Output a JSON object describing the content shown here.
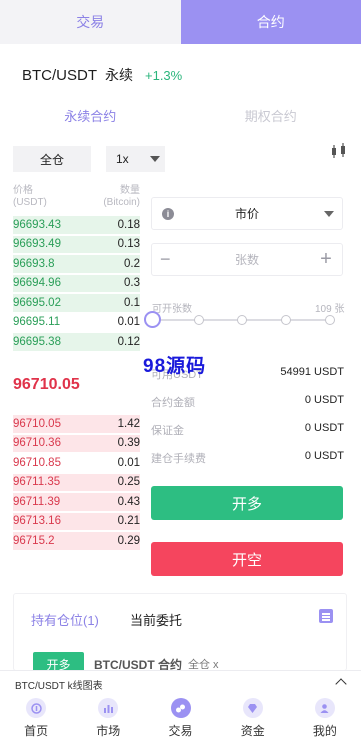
{
  "top_tabs": {
    "spot": "交易",
    "contract": "合约"
  },
  "pair": {
    "name": "BTC/USDT",
    "type": "永续",
    "change": "+1.3%"
  },
  "sub_tabs": {
    "perpetual": "永续合约",
    "futures": "期权合约"
  },
  "margin_mode": "全仓",
  "leverage": "1x",
  "order_book": {
    "price_header": "价格",
    "price_unit": "(USDT)",
    "qty_header": "数量",
    "qty_unit": "(Bitcoin)",
    "bids": [
      {
        "price": "96693.43",
        "qty": "0.18",
        "depth": 1.0
      },
      {
        "price": "96693.49",
        "qty": "0.13",
        "depth": 1.0
      },
      {
        "price": "96693.8",
        "qty": "0.2",
        "depth": 1.0
      },
      {
        "price": "96694.96",
        "qty": "0.3",
        "depth": 1.0
      },
      {
        "price": "96695.02",
        "qty": "0.1",
        "depth": 1.0
      },
      {
        "price": "96695.11",
        "qty": "0.01",
        "depth": 0.0
      },
      {
        "price": "96695.38",
        "qty": "0.12",
        "depth": 1.0
      }
    ],
    "last_price": "96710.05",
    "asks": [
      {
        "price": "96710.05",
        "qty": "1.42",
        "depth": 1.0
      },
      {
        "price": "96710.36",
        "qty": "0.39",
        "depth": 1.0
      },
      {
        "price": "96710.85",
        "qty": "0.01",
        "depth": 0.0
      },
      {
        "price": "96711.35",
        "qty": "0.25",
        "depth": 1.0
      },
      {
        "price": "96711.39",
        "qty": "0.43",
        "depth": 1.0
      },
      {
        "price": "96713.16",
        "qty": "0.21",
        "depth": 1.0
      },
      {
        "price": "96715.2",
        "qty": "0.29",
        "depth": 1.0
      }
    ]
  },
  "order_form": {
    "order_type": "市价",
    "quantity_placeholder": "张数",
    "open_label": "可开张数",
    "max_open": "109 张",
    "available_label": "可用USDT",
    "available_value": "54991 USDT",
    "contract_amount_label": "合约金额",
    "contract_amount_value": "0 USDT",
    "margin_label": "保证金",
    "margin_value": "0 USDT",
    "fee_label": "建仓手续费",
    "fee_value": "0 USDT",
    "long_button": "开多",
    "short_button": "开空"
  },
  "watermark": "98源码",
  "positions": {
    "holding_tab": "持有仓位(1)",
    "orders_tab": "当前委托",
    "peek_badge": "开多",
    "peek_name": "BTC/USDT 合约",
    "peek_mode": "全仓 x"
  },
  "kline_bar": "BTC/USDT k线图表",
  "bottom_nav": [
    "首页",
    "市场",
    "交易",
    "资金",
    "我的"
  ],
  "colors": {
    "accent": "#9b91f2",
    "up": "#2dbe82",
    "down": "#f5455e"
  }
}
